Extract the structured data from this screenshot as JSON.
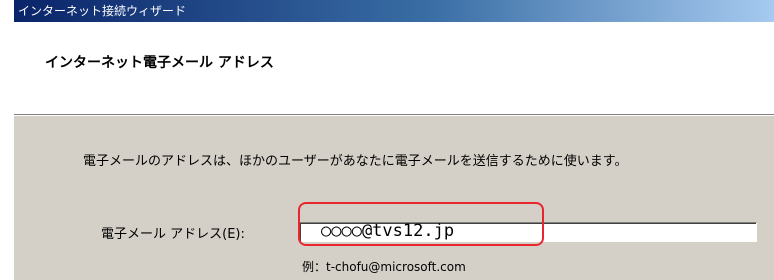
{
  "window": {
    "title": "インターネット接続ウィザード"
  },
  "header": {
    "title": "インターネット電子メール アドレス"
  },
  "main": {
    "description": "電子メールのアドレスは、ほかのユーザーがあなたに電子メールを送信するために使います。",
    "email_label": "電子メール アドレス(E):",
    "email_value": "○○○○@tvs12.jp",
    "example": "例：t-chofu@microsoft.com"
  },
  "colors": {
    "titlebar_start": "#0a246a",
    "titlebar_end": "#a6caf0",
    "dialog_face": "#d4d0c8",
    "highlight_border": "#e8262e"
  }
}
